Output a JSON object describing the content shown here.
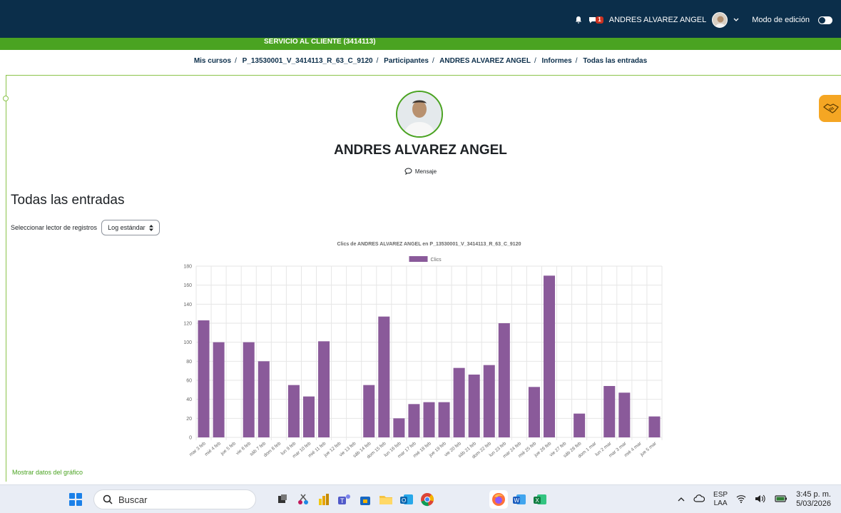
{
  "header": {
    "user_name": "ANDRES ALVAREZ ANGEL",
    "message_count": "1",
    "edit_mode_label": "Modo de edición",
    "course_banner": "SERVICIO AL CLIENTE (3414113)"
  },
  "breadcrumb": [
    "Mis cursos",
    "P_13530001_V_3414113_R_63_C_9120",
    "Participantes",
    "ANDRES ALVAREZ ANGEL",
    "Informes",
    "Todas las entradas"
  ],
  "profile": {
    "name": "ANDRES ALVAREZ ANGEL",
    "message_label": "Mensaje"
  },
  "page": {
    "title": "Todas las entradas",
    "selector_label": "Seleccionar lector de registros",
    "selector_value": "Log estándar",
    "show_data_link": "Mostrar datos del gráfico"
  },
  "colors": {
    "topbar": "#0b2e4a",
    "green": "#4aa321",
    "bar": "#8a5a9a"
  },
  "chart_data": {
    "type": "bar",
    "title": "Clics de ANDRES ALVAREZ ANGEL  en P_13530001_V_3414113_R_63_C_9120",
    "legend": "Clics",
    "legend_position": "top",
    "grid": true,
    "ylim": [
      0,
      180
    ],
    "yticks": [
      0,
      20,
      40,
      60,
      80,
      100,
      120,
      140,
      160,
      180
    ],
    "categories": [
      "mar 3 feb",
      "mié 4 feb",
      "jue 5 feb",
      "vie 6 feb",
      "sáb 7 feb",
      "dom 8 feb",
      "lun 9 feb",
      "mar 10 feb",
      "mié 11 feb",
      "jue 12 feb",
      "vie 13 feb",
      "sáb 14 feb",
      "dom 15 feb",
      "lun 16 feb",
      "mar 17 feb",
      "mié 18 feb",
      "jue 19 feb",
      "vie 20 feb",
      "sáb 21 feb",
      "dom 22 feb",
      "lun 23 feb",
      "mar 24 feb",
      "mié 25 feb",
      "jue 26 feb",
      "vie 27 feb",
      "sáb 28 feb",
      "dom 1 mar",
      "lun 2 mar",
      "mar 3 mar",
      "mié 4 mar",
      "jue 5 mar"
    ],
    "series": [
      {
        "name": "Clics",
        "values": [
          123,
          100,
          0,
          100,
          80,
          0,
          55,
          43,
          101,
          0,
          0,
          55,
          127,
          20,
          35,
          37,
          37,
          73,
          66,
          76,
          120,
          0,
          53,
          170,
          0,
          25,
          0,
          54,
          47,
          0,
          22
        ]
      }
    ]
  },
  "taskbar": {
    "search_placeholder": "Buscar",
    "lang": "ESP",
    "lang_sub": "LAA",
    "time": "3:45 p. m.",
    "date": "5/03/2026"
  }
}
